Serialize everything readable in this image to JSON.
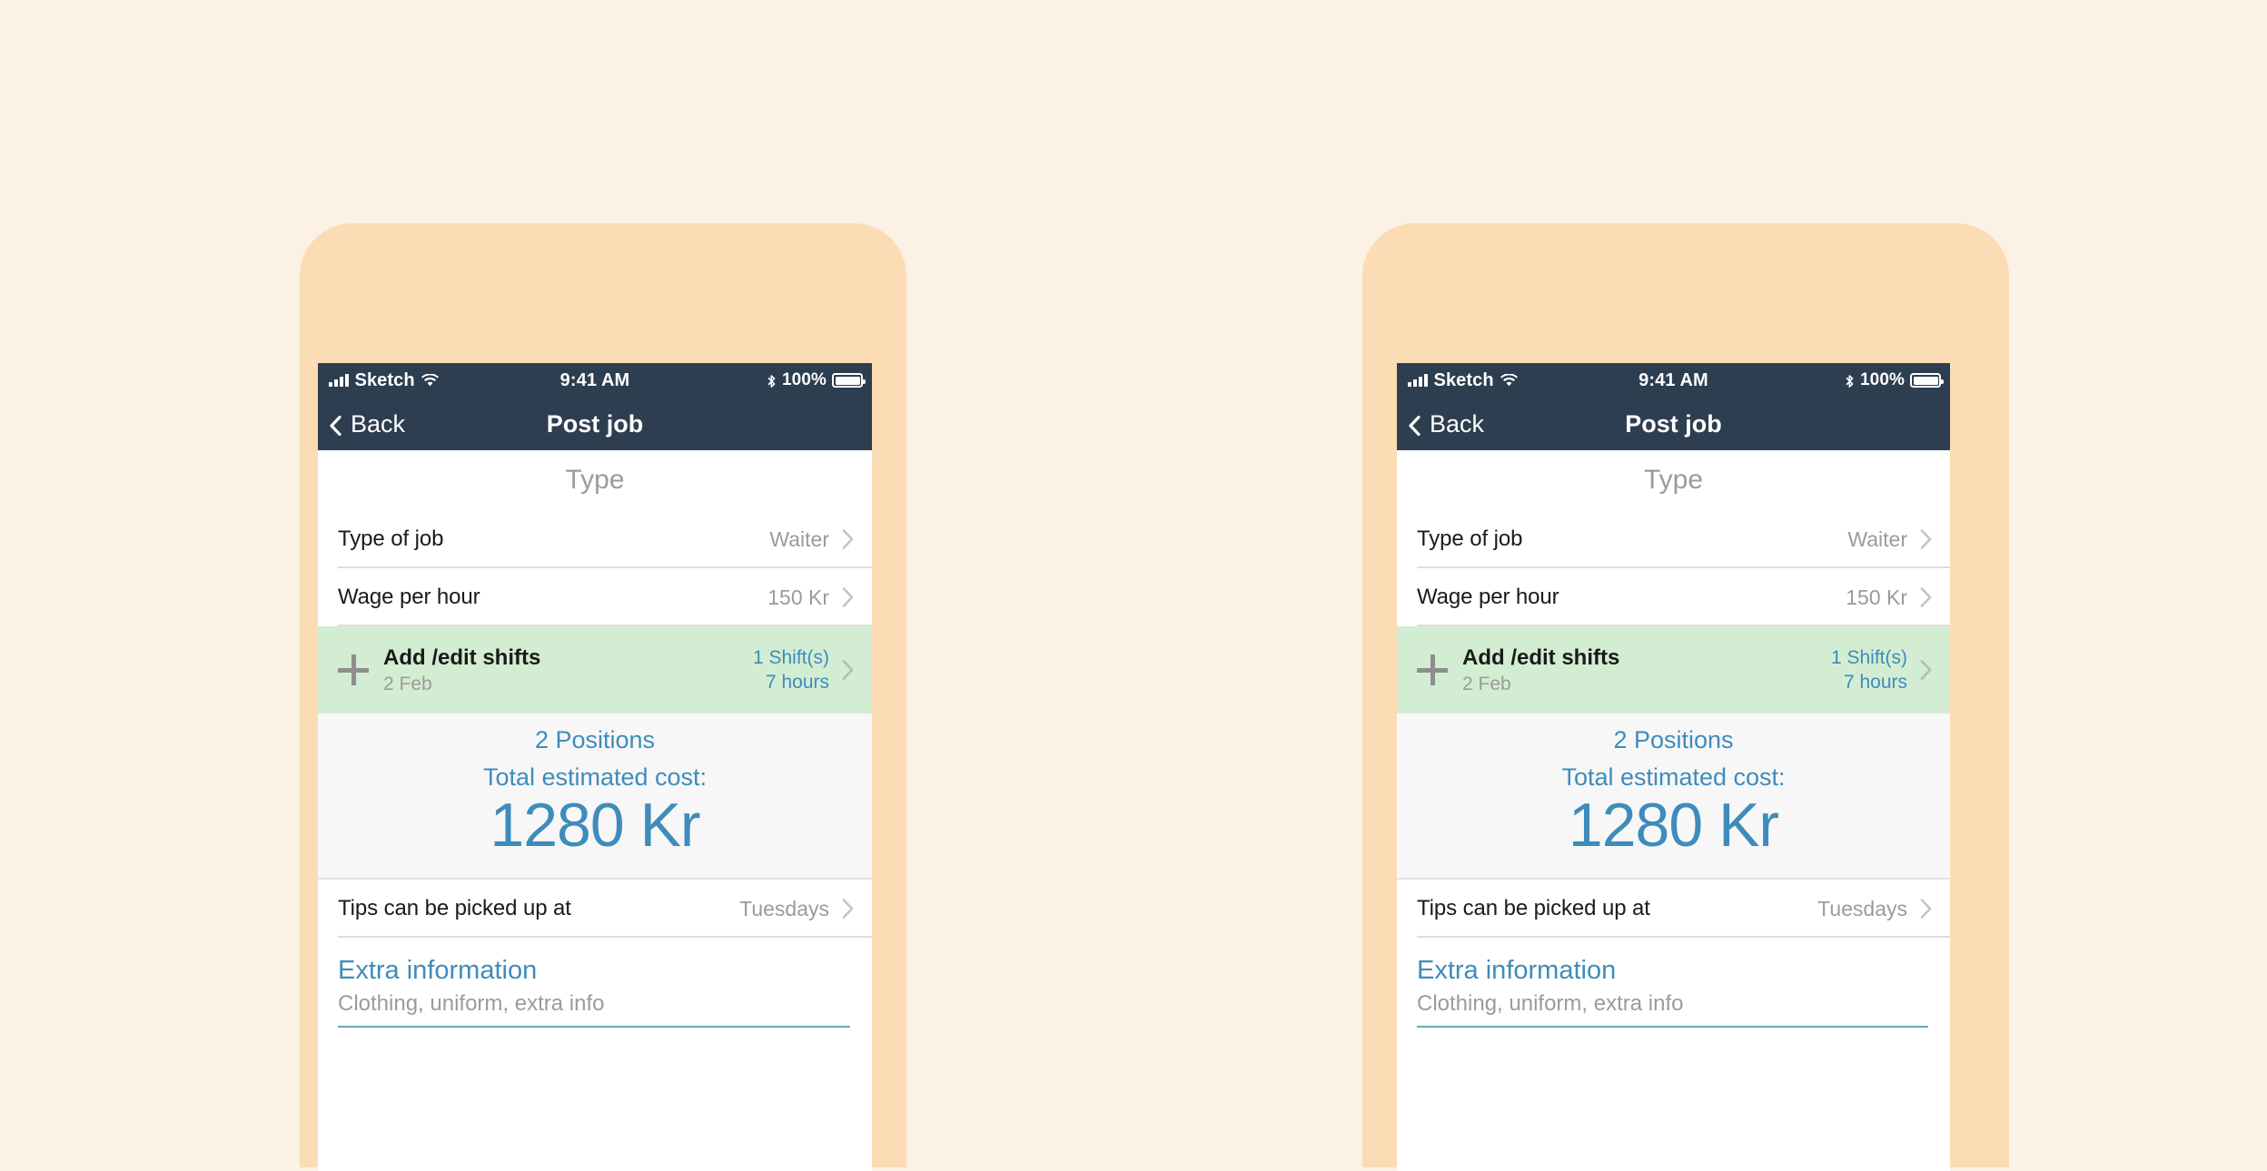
{
  "page": {
    "background_color": "#FBF1E4",
    "device_frame_color": "#FBDCB4"
  },
  "colors": {
    "navbar": "#2D3E50",
    "accent_blue": "#3E8CBB",
    "highlight_green": "#D3EDD3",
    "muted_text": "#9B9B9B",
    "summary_background": "#F7F7F7",
    "underline": "#6FA8B8"
  },
  "status_bar": {
    "carrier": "Sketch",
    "signal_icon": "signal-bars-icon",
    "wifi_icon": "wifi-icon",
    "time": "9:41 AM",
    "bluetooth_icon": "bluetooth-icon",
    "battery_percent": "100%",
    "battery_icon": "battery-full-icon"
  },
  "navbar": {
    "back_icon": "chevron-left-icon",
    "back_label": "Back",
    "title": "Post job"
  },
  "section": {
    "title": "Type"
  },
  "rows": [
    {
      "label": "Type of job",
      "value": "Waiter",
      "chevron": "chevron-right-icon"
    },
    {
      "label": "Wage per hour",
      "value": "150 Kr",
      "chevron": "chevron-right-icon"
    }
  ],
  "shifts_row": {
    "icon": "plus-icon",
    "title": "Add /edit shifts",
    "subtitle": "2 Feb",
    "value_line1": "1 Shift(s)",
    "value_line2": "7 hours",
    "chevron": "chevron-right-icon"
  },
  "summary": {
    "positions": "2 Positions",
    "cost_label": "Total estimated cost:",
    "cost_amount": "1280 Kr"
  },
  "tips_row": {
    "label": "Tips can be picked up at",
    "value": "Tuesdays",
    "chevron": "chevron-right-icon"
  },
  "extra_information": {
    "title": "Extra information",
    "placeholder": "Clothing, uniform, extra info",
    "value": ""
  }
}
